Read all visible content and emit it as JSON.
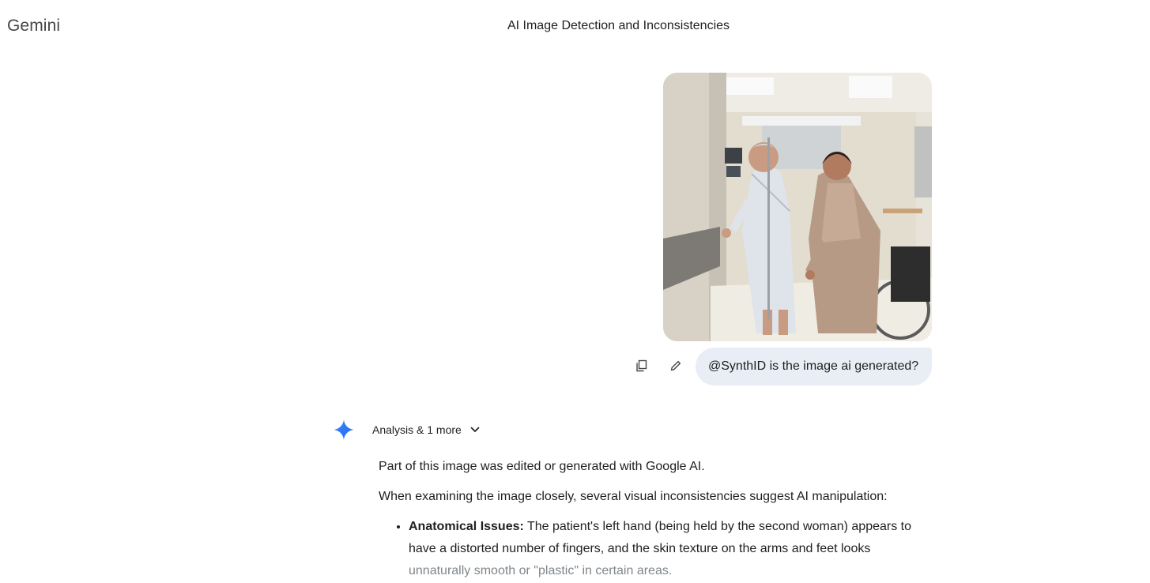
{
  "app": {
    "brand": "Gemini",
    "conversation_title": "AI Image Detection and Inconsistencies"
  },
  "user_turn": {
    "prompt": "@SynthID is the image ai generated?",
    "image_icon": "hospital-photo",
    "actions": {
      "copy_icon": "copy-icon",
      "edit_icon": "pencil-icon"
    }
  },
  "model_turn": {
    "icon": "gemini-sparkle-icon",
    "thoughts_label": "Analysis & 1 more",
    "paragraphs": [
      "Part of this image was edited or generated with Google AI.",
      "When examining the image closely, several visual inconsistencies suggest AI manipulation:"
    ],
    "bullets": [
      {
        "title": "Anatomical Issues:",
        "text": " The patient's left hand (being held by the second woman) appears to have a distorted number of fingers, and the skin texture on the arms and feet looks ",
        "faded_text": "unnaturally smooth or \"plastic\" in certain areas."
      }
    ]
  },
  "colors": {
    "bubble": "#e9eef6",
    "sparkle": "#4285f4",
    "text": "#1f1f1f",
    "muted": "#444746"
  }
}
